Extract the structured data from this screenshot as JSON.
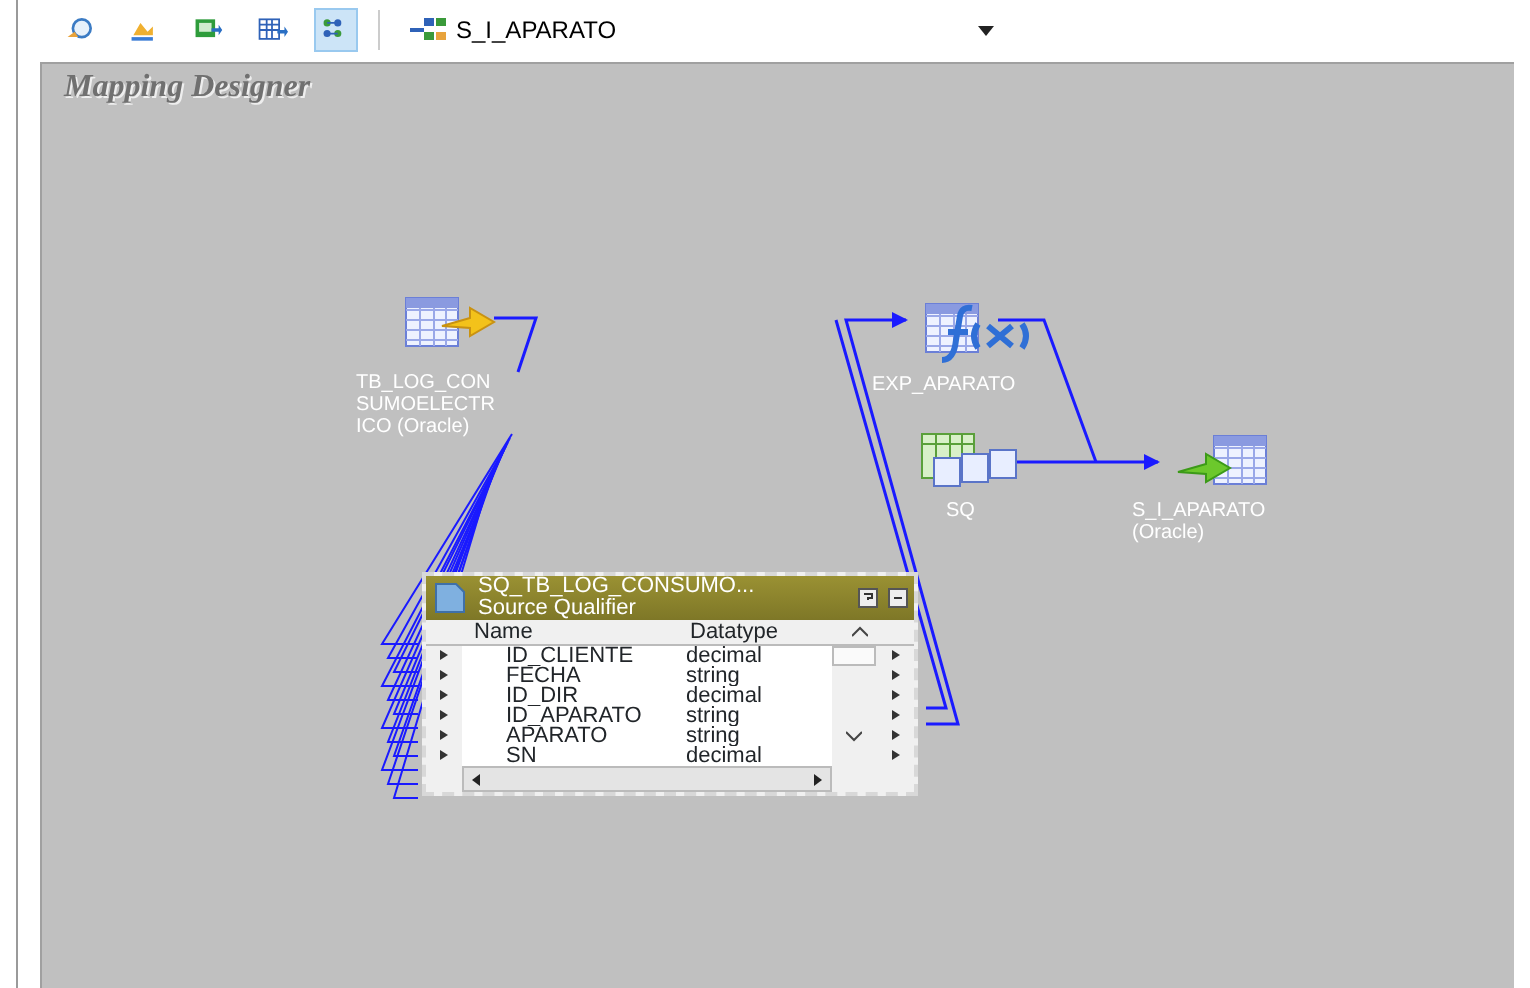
{
  "toolbar": {
    "buttons": [
      {
        "kind": "find",
        "selected": false
      },
      {
        "kind": "chart",
        "selected": false
      },
      {
        "kind": "table-in",
        "selected": false
      },
      {
        "kind": "table-out",
        "selected": false
      },
      {
        "kind": "layout",
        "selected": true
      }
    ],
    "mapping_select": {
      "value": "S_I_APARATO"
    }
  },
  "designer": {
    "title": "Mapping Designer",
    "nodes": [
      {
        "kind": "source",
        "label": "TB_LOG_CONSUMOELECTRICO (Oracle)"
      },
      {
        "kind": "expression",
        "label": "EXP_APARATO"
      },
      {
        "kind": "sequence",
        "label": "SQ"
      },
      {
        "kind": "target",
        "label": "S_I_APARATO (Oracle)"
      }
    ],
    "qualifier": {
      "title": "SQ_TB_LOG_CONSUMO...",
      "subtitle": "Source Qualifier",
      "columns": [
        "Name",
        "Datatype"
      ],
      "rows": [
        {
          "name": "ID_CLIENTE",
          "datatype": "decimal"
        },
        {
          "name": "FECHA",
          "datatype": "string"
        },
        {
          "name": "ID_DIR",
          "datatype": "decimal"
        },
        {
          "name": "ID_APARATO",
          "datatype": "string"
        },
        {
          "name": "APARATO",
          "datatype": "string"
        },
        {
          "name": "SN",
          "datatype": "decimal"
        }
      ]
    }
  }
}
